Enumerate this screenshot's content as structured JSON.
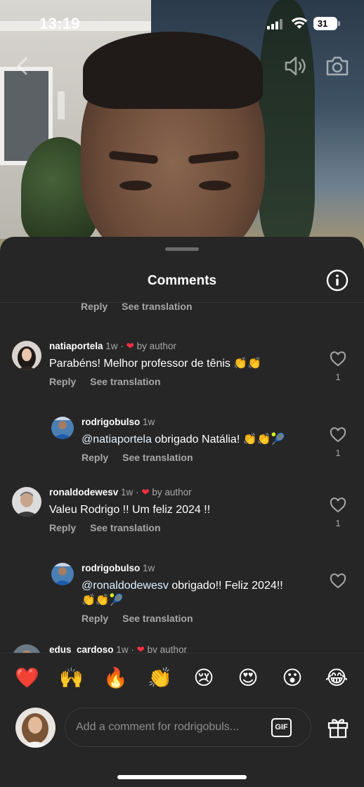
{
  "status_bar": {
    "time": "13:19",
    "battery": "31"
  },
  "sheet": {
    "title": "Comments"
  },
  "partial_actions": {
    "reply": "Reply",
    "translate": "See translation"
  },
  "comments": [
    {
      "username": "natiaportela",
      "time": "1w",
      "liked_by": "by author",
      "text": "Parabéns! Melhor professor de tênis 👏👏",
      "reply": "Reply",
      "translate": "See translation",
      "likes": "1"
    },
    {
      "username": "rodrigobulso",
      "time": "1w",
      "mention": "@natiaportela",
      "text": " obrigado Natália! 👏👏🎾",
      "reply": "Reply",
      "translate": "See translation",
      "likes": "1"
    },
    {
      "username": "ronaldodewesv",
      "time": "1w",
      "liked_by": "by author",
      "text": "Valeu Rodrigo !! Um feliz 2024 !!",
      "reply": "Reply",
      "translate": "See translation",
      "likes": "1"
    },
    {
      "username": "rodrigobulso",
      "time": "1w",
      "mention": "@ronaldodewesv",
      "text": " obrigado!! Feliz 2024!!",
      "text2": "👏👏🎾",
      "reply": "Reply",
      "translate": "See translation"
    },
    {
      "username": "edus_cardoso",
      "time": "1w",
      "liked_by": "by author"
    }
  ],
  "emoji_bar": [
    "❤️",
    "🙌",
    "🔥",
    "👏",
    "😢",
    "😍",
    "😮",
    "😂"
  ],
  "composer": {
    "placeholder": "Add a comment for rodrigobuls...",
    "gif_label": "GIF"
  },
  "colors": {
    "sheet_bg": "#262626",
    "heart": "#ff3040",
    "secondary_text": "#a8a8a8"
  }
}
